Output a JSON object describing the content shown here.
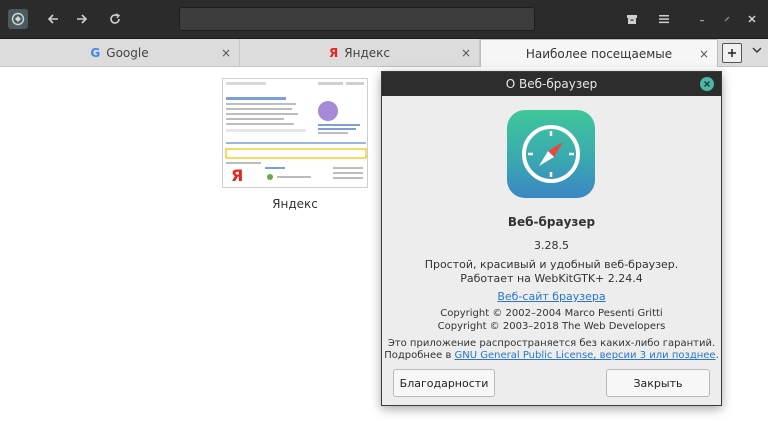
{
  "tabs": [
    {
      "label": "Google",
      "icon": "google-icon",
      "close": "×"
    },
    {
      "label": "Яндекс",
      "icon": "yandex-icon",
      "close": "×"
    },
    {
      "label": "Наиболее посещаемые",
      "close": "×"
    }
  ],
  "url": {
    "value": ""
  },
  "content": {
    "most_visited": [
      {
        "title": "Яндекс"
      }
    ]
  },
  "about_dialog": {
    "title": "О Веб-браузер",
    "app_name": "Веб-браузер",
    "version": "3.28.5",
    "description_line1": "Простой, красивый и удобный веб-браузер.",
    "description_line2": "Работает на WebKitGTK+ 2.24.4",
    "website_link": "Веб-сайт браузера",
    "copyright1": "Copyright © 2002–2004 Marco Pesenti Gritti",
    "copyright2": "Copyright © 2003–2018 The Web Developers",
    "warranty_line1": "Это приложение распространяется без каких-либо гарантий.",
    "warranty_prefix": "Подробнее в ",
    "license_link": "GNU General Public License, версии 3 или позднее",
    "warranty_suffix": ".",
    "credits_button": "Благодарности",
    "close_button": "Закрыть"
  },
  "colors": {
    "accent": "#48b9a7",
    "link": "#2a76c6",
    "headerbar": "#2b2b2b"
  }
}
